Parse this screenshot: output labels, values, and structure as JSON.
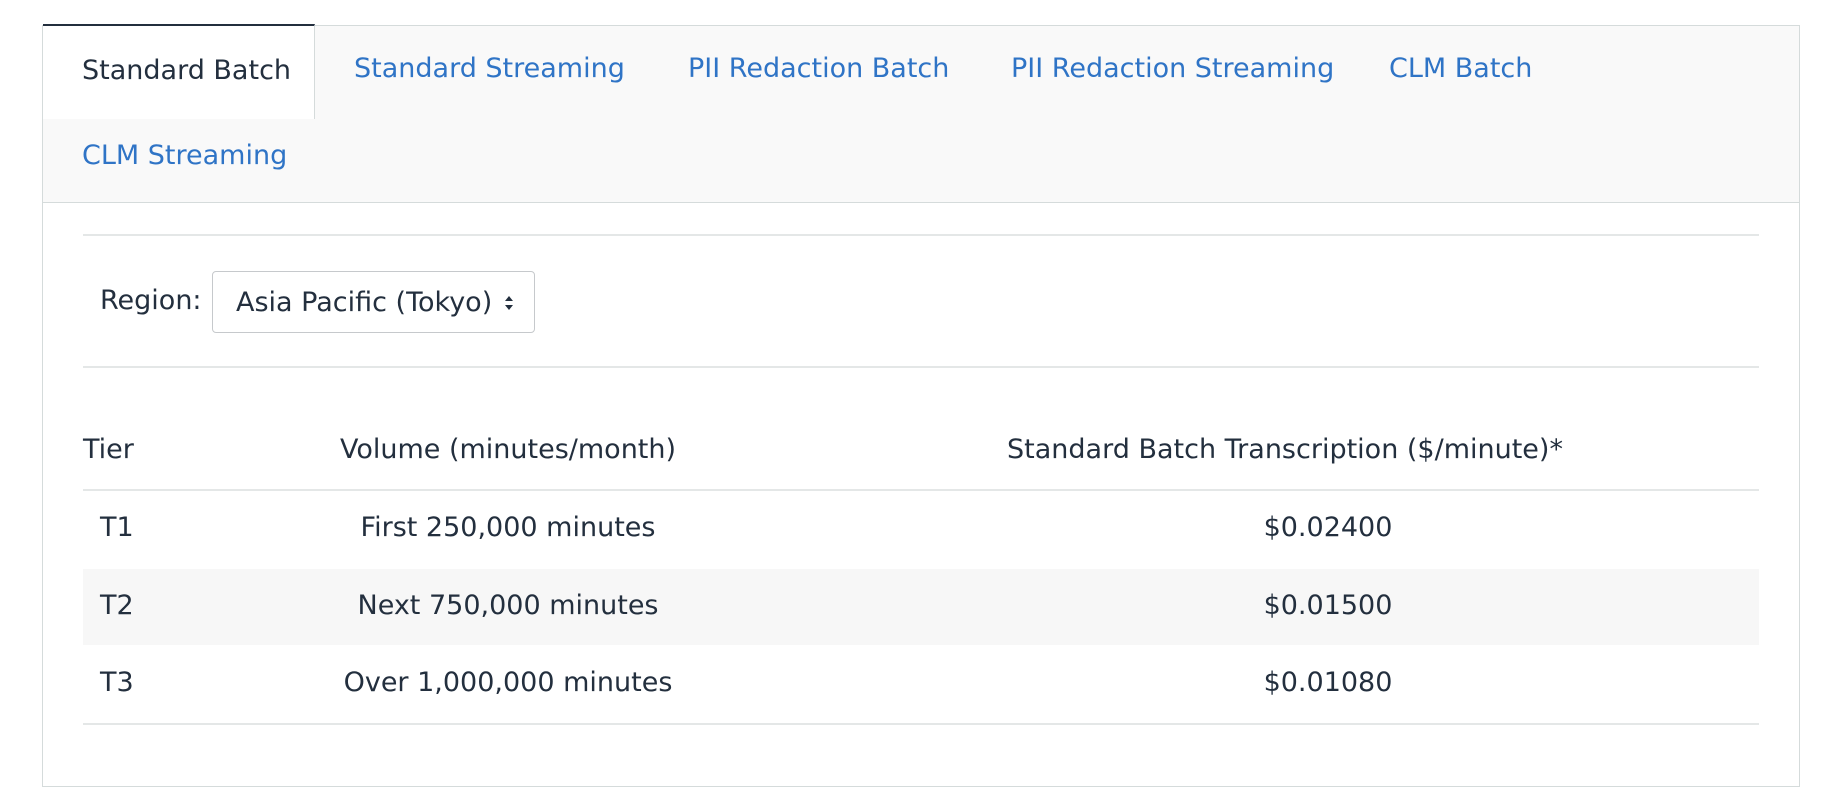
{
  "tabs": [
    {
      "label": "Standard Batch",
      "active": true
    },
    {
      "label": "Standard Streaming",
      "active": false
    },
    {
      "label": "PII Redaction Batch",
      "active": false
    },
    {
      "label": "PII Redaction Streaming",
      "active": false
    },
    {
      "label": "CLM Batch",
      "active": false
    },
    {
      "label": "CLM Streaming",
      "active": false
    }
  ],
  "region": {
    "label": "Region:",
    "selected": "Asia Pacific (Tokyo)"
  },
  "table": {
    "headers": [
      "Tier",
      "Volume (minutes/month)",
      "Standard Batch Transcription ($/minute)*"
    ],
    "rows": [
      {
        "tier": "T1",
        "volume": "First 250,000 minutes",
        "price": "$0.02400"
      },
      {
        "tier": "T2",
        "volume": "Next 750,000 minutes",
        "price": "$0.01500"
      },
      {
        "tier": "T3",
        "volume": "Over 1,000,000 minutes",
        "price": "$0.01080"
      }
    ]
  },
  "colors": {
    "link": "#2f74c6",
    "text": "#232f3e",
    "tabbar_bg": "#f9f9f9",
    "border": "#d5dbdb",
    "row_alt": "#f7f7f7"
  }
}
